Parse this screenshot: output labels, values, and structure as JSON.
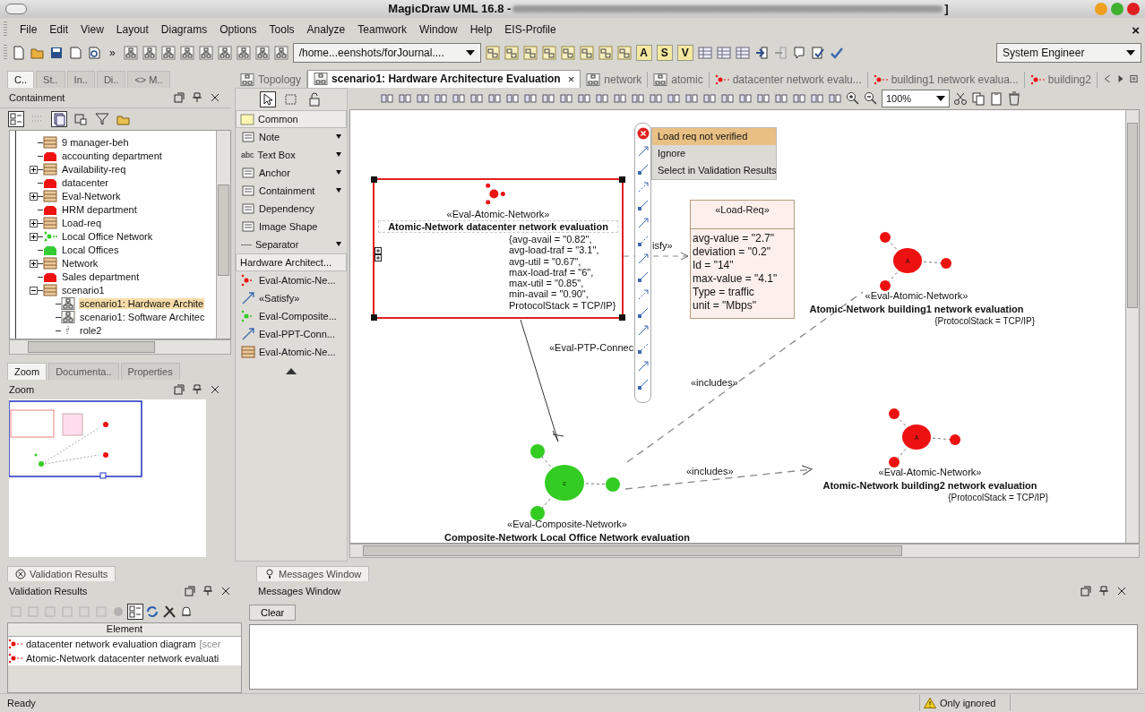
{
  "window": {
    "title": "MagicDraw UML 16.8 -",
    "title_tail": "]",
    "close_glyph": "×"
  },
  "menu": [
    "File",
    "Edit",
    "View",
    "Layout",
    "Diagrams",
    "Options",
    "Tools",
    "Analyze",
    "Teamwork",
    "Window",
    "Help",
    "EIS-Profile"
  ],
  "toolbar": {
    "overflow": "»",
    "path_combo": "/home...eenshots/forJournal....",
    "letters": [
      "A",
      "S",
      "V"
    ],
    "perspective": "System Engineer"
  },
  "browser": {
    "tabs": [
      {
        "label": "C..",
        "selected": true
      },
      {
        "label": "St..",
        "selected": false
      },
      {
        "label": "In..",
        "selected": false
      },
      {
        "label": "Di..",
        "selected": false
      },
      {
        "label": "<> M..",
        "selected": false
      }
    ],
    "title": "Containment",
    "tree": [
      {
        "label": "9 manager-beh",
        "kind": "class",
        "selected": false
      },
      {
        "label": "accounting department",
        "kind": "node",
        "color": "#ee1111",
        "selected": false
      },
      {
        "label": "Availability-req",
        "kind": "class",
        "expanded": false,
        "selected": false
      },
      {
        "label": "datacenter",
        "kind": "node",
        "color": "#ee1111",
        "selected": false
      },
      {
        "label": "Eval-Network",
        "kind": "class",
        "expanded": false,
        "selected": false
      },
      {
        "label": "HRM department",
        "kind": "node",
        "color": "#ee1111",
        "selected": false
      },
      {
        "label": "Load-req",
        "kind": "class",
        "expanded": false,
        "selected": false
      },
      {
        "label": "Local Office Network",
        "kind": "network",
        "expanded": false,
        "selected": false
      },
      {
        "label": "Local Offices",
        "kind": "node",
        "color": "#33cc33",
        "selected": false
      },
      {
        "label": "Network",
        "kind": "class",
        "expanded": false,
        "selected": false
      },
      {
        "label": "Sales department",
        "kind": "node",
        "color": "#ee1111",
        "selected": false
      },
      {
        "label": "scenario1",
        "kind": "class",
        "expanded": true,
        "selected": false,
        "children": [
          {
            "label": "scenario1: Hardware  Archite",
            "kind": "diagram",
            "selected": true
          },
          {
            "label": "scenario1: Software Architec",
            "kind": "diagram",
            "selected": false
          },
          {
            "label": "role2",
            "kind": "role",
            "selected": false
          }
        ]
      }
    ]
  },
  "lower_left": {
    "tabs": [
      {
        "label": "Zoom",
        "selected": true
      },
      {
        "label": "Documenta..",
        "selected": false
      },
      {
        "label": "Properties",
        "selected": false
      }
    ],
    "title": "Zoom"
  },
  "diagram_tabs": [
    {
      "label": "Topology",
      "kind": "diagram",
      "selected": false
    },
    {
      "label": "scenario1: Hardware  Architecture Evaluation",
      "kind": "diagram",
      "selected": true,
      "close": "×"
    },
    {
      "label": "network",
      "kind": "diagram",
      "selected": false
    },
    {
      "label": "atomic",
      "kind": "diagram",
      "selected": false
    },
    {
      "label": "datacenter network evalu...",
      "kind": "network",
      "selected": false
    },
    {
      "label": "building1 network evalua...",
      "kind": "network",
      "selected": false
    },
    {
      "label": "building2",
      "kind": "network",
      "selected": false
    }
  ],
  "palette": {
    "groups": [
      {
        "title": "Common",
        "items": [
          {
            "label": "Note",
            "dropdown": true
          },
          {
            "label": "Text Box",
            "dropdown": true,
            "prefix": "abc"
          },
          {
            "label": "Anchor",
            "dropdown": true
          },
          {
            "label": "Containment",
            "dropdown": true
          },
          {
            "label": "Dependency",
            "dropdown": false
          },
          {
            "label": "Image Shape",
            "dropdown": false
          },
          {
            "label": "Separator",
            "dropdown": true,
            "prefix": "----"
          }
        ]
      },
      {
        "title": "Hardware Architect...",
        "items": [
          {
            "label": "Eval-Atomic-Ne...",
            "dropdown": false
          },
          {
            "label": "«Satisfy»",
            "dropdown": false
          },
          {
            "label": "Eval-Composite...",
            "dropdown": false
          },
          {
            "label": "Eval-PPT-Conn...",
            "dropdown": false
          },
          {
            "label": "Eval-Atomic-Ne...",
            "dropdown": false
          }
        ]
      }
    ]
  },
  "zoom_value": "100%",
  "diagram": {
    "part": {
      "stereotype": "«Eval-Atomic-Network»",
      "name": "Atomic-Network datacenter network evaluation",
      "tags": [
        "{avg-avail = \"0.82\",",
        "avg-load-traf = \"3.1\",",
        "avg-util = \"0.67\",",
        "max-load-traf = \"6\",",
        "max-util = \"0.85\",",
        "min-avail = \"0.90\",",
        "ProtocolStack = TCP/IP}"
      ],
      "selected": true,
      "invalid": true
    },
    "requirement": {
      "stereotype": "«Load-Req»",
      "properties": [
        "avg-value = \"2.7\"",
        "deviation = \"0.2\"",
        "Id = \"14\"",
        "max-value = \"4.1\"",
        "Type = traffic",
        "unit = \"Mbps\""
      ]
    },
    "networks": [
      {
        "kind": "atomic",
        "symbol": "A",
        "stereotype": "«Eval-Atomic-Network»",
        "name": "Atomic-Network building1 network evaluation",
        "tags": "{ProtocolStack = TCP/IP}"
      },
      {
        "kind": "atomic",
        "symbol": "A",
        "stereotype": "«Eval-Atomic-Network»",
        "name": "Atomic-Network building2 network evaluation",
        "tags": "{ProtocolStack = TCP/IP}"
      },
      {
        "kind": "composite",
        "symbol": "c",
        "stereotype": "«Eval-Composite-Network»",
        "name": "Composite-Network Local Office Network evaluation"
      }
    ],
    "edge_labels": [
      "«Eval-PTP-Connec",
      "isfy»",
      "«includes»",
      "«includes»"
    ],
    "context_menu": [
      {
        "label": "Load req not verified",
        "selected": true
      },
      {
        "label": "Ignore",
        "selected": false
      },
      {
        "label": "Select in Validation Results",
        "selected": false
      }
    ]
  },
  "validation": {
    "tab": "Validation Results",
    "title": "Validation Results",
    "column": "Element",
    "rows": [
      {
        "text": "datacenter network evaluation diagram",
        "note": "[scer"
      },
      {
        "text": "Atomic-Network datacenter network evaluati"
      }
    ]
  },
  "messages": {
    "tab": "Messages Window",
    "title": "Messages Window",
    "button": "Clear"
  },
  "status": {
    "text": "Ready",
    "validation": "Only ignored"
  }
}
